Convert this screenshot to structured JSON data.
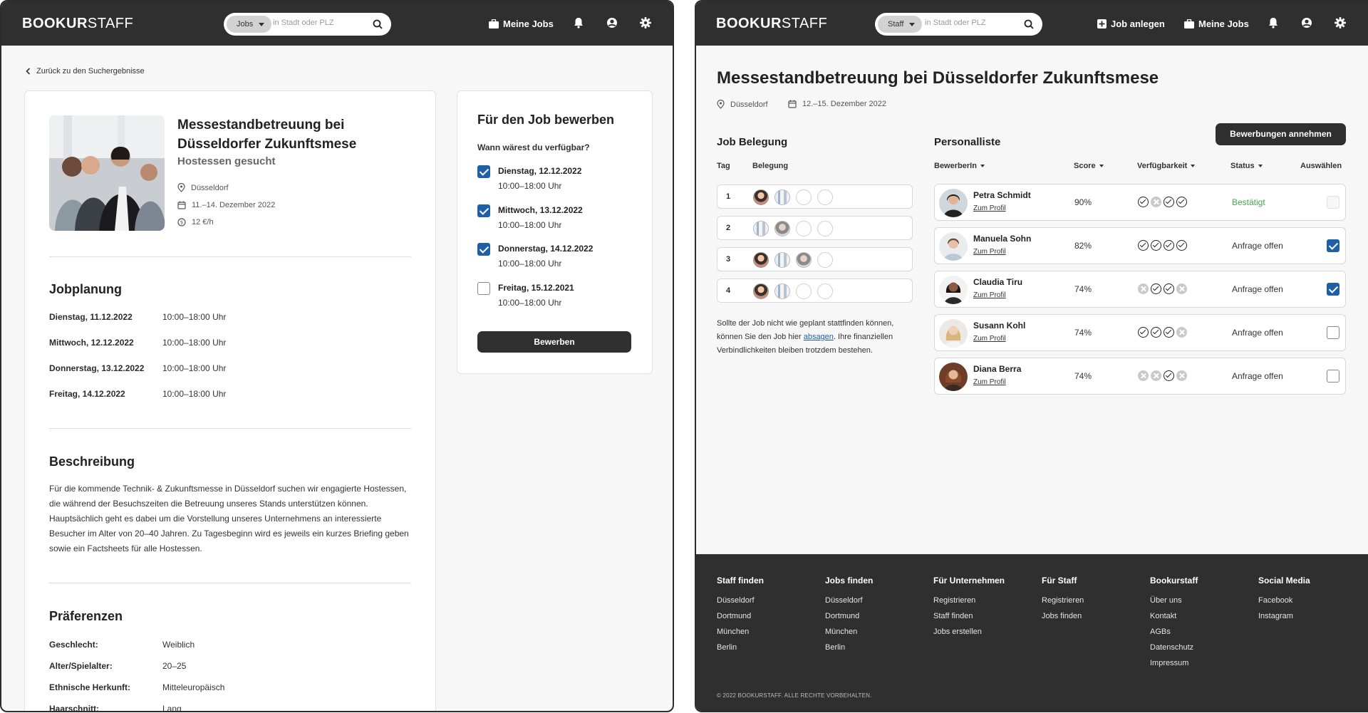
{
  "brand": {
    "name_bold": "BOOKUR",
    "name_thin": "STAFF"
  },
  "left": {
    "search": {
      "pill": "Jobs",
      "placeholder": "in Stadt oder PLZ"
    },
    "nav": {
      "my_jobs": "Meine Jobs"
    },
    "back": "Zurück zu den Suchergebnisse",
    "job": {
      "title": "Messestandbetreuung bei Düsseldorfer Zukunftsmese",
      "subtitle": "Hostessen gesucht",
      "location": "Düsseldorf",
      "date": "11.–14. Dezember 2022",
      "wage": "12 €/h"
    },
    "plan": {
      "heading": "Jobplanung",
      "rows": [
        {
          "day": "Dienstag, 11.12.2022",
          "time": "10:00–18:00 Uhr"
        },
        {
          "day": "Mittwoch, 12.12.2022",
          "time": "10:00–18:00 Uhr"
        },
        {
          "day": "Donnerstag, 13.12.2022",
          "time": "10:00–18:00 Uhr"
        },
        {
          "day": "Freitag, 14.12.2022",
          "time": "10:00–18:00 Uhr"
        }
      ]
    },
    "description": {
      "heading": "Beschreibung",
      "text": "Für die kommende Technik- & Zukunftsmesse in Düsseldorf suchen wir engagierte Hostessen, die während der Besuchszeiten die Betreuung unseres Stands unterstützen können. Hauptsächlich geht es dabei um die Vorstellung unseres Unternehmens an interessierte Besucher im Alter von 20–40 Jahren. Zu Tagesbeginn wird es jeweils ein kurzes Briefing geben sowie ein Factsheets für alle Hostessen."
    },
    "preferences": {
      "heading": "Präferenzen",
      "rows": [
        {
          "label": "Geschlecht:",
          "value": "Weiblich"
        },
        {
          "label": "Alter/Spielalter:",
          "value": "20–25"
        },
        {
          "label": "Ethnische Herkunft:",
          "value": "Mitteleuropäisch"
        },
        {
          "label": "Haarschnitt:",
          "value": "Lang"
        }
      ]
    },
    "apply": {
      "title": "Für den Job bewerben",
      "question": "Wann wärest du verfügbar?",
      "options": [
        {
          "day": "Dienstag, 12.12.2022",
          "time": "10:00–18:00 Uhr",
          "checked": true
        },
        {
          "day": "Mittwoch, 13.12.2022",
          "time": "10:00–18:00 Uhr",
          "checked": true
        },
        {
          "day": "Donnerstag, 14.12.2022",
          "time": "10:00–18:00 Uhr",
          "checked": true
        },
        {
          "day": "Freitag, 15.12.2021",
          "time": "10:00–18:00 Uhr",
          "checked": false
        }
      ],
      "button": "Bewerben"
    }
  },
  "right": {
    "search": {
      "pill": "Staff",
      "placeholder": "in Stadt oder PLZ"
    },
    "nav": {
      "create_job": "Job anlegen",
      "my_jobs": "Meine Jobs"
    },
    "title": "Messestandbetreuung bei Düsseldorfer Zukunftsmese",
    "location": "Düsseldorf",
    "date": "12.–15. Dezember 2022",
    "belegung": {
      "heading": "Job Belegung",
      "col_day": "Tag",
      "col_assign": "Belegung",
      "rows": [
        {
          "day": "1",
          "slots": [
            "f1",
            "f2",
            "",
            ""
          ]
        },
        {
          "day": "2",
          "slots": [
            "f2",
            "f3",
            "",
            ""
          ]
        },
        {
          "day": "3",
          "slots": [
            "f1",
            "f2",
            "f3",
            ""
          ]
        },
        {
          "day": "4",
          "slots": [
            "f1",
            "f2",
            "",
            ""
          ]
        }
      ],
      "note_before": "Sollte der Job nicht wie geplant stattfinden können, können Sie den Job hier ",
      "note_link": "absagen",
      "note_after": ". Ihre finanziellen Verbindlichkeiten bleiben trotzdem bestehen."
    },
    "staff": {
      "heading": "Personalliste",
      "accept_button": "Bewerbungen annehmen",
      "cols": {
        "applicant": "BewerberIn",
        "score": "Score",
        "availability": "Verfügbarkeit",
        "status": "Status",
        "select": "Auswählen"
      },
      "rows": [
        {
          "name": "Petra Schmidt",
          "profile": "Zum Profil",
          "score": "90%",
          "avail": [
            true,
            false,
            true,
            true
          ],
          "status": "Bestätigt",
          "confirmed": true,
          "selected": false
        },
        {
          "name": "Manuela Sohn",
          "profile": "Zum Profil",
          "score": "82%",
          "avail": [
            true,
            true,
            true,
            true
          ],
          "status": "Anfrage offen",
          "confirmed": false,
          "selected": true
        },
        {
          "name": "Claudia Tiru",
          "profile": "Zum Profil",
          "score": "74%",
          "avail": [
            false,
            true,
            true,
            false
          ],
          "status": "Anfrage offen",
          "confirmed": false,
          "selected": true
        },
        {
          "name": "Susann Kohl",
          "profile": "Zum Profil",
          "score": "74%",
          "avail": [
            true,
            true,
            true,
            false
          ],
          "status": "Anfrage offen",
          "confirmed": false,
          "selected": false
        },
        {
          "name": "Diana Berra",
          "profile": "Zum Profil",
          "score": "74%",
          "avail": [
            false,
            false,
            true,
            false
          ],
          "status": "Anfrage offen",
          "confirmed": false,
          "selected": false
        }
      ]
    },
    "footer": {
      "columns": [
        {
          "heading": "Staff finden",
          "links": [
            "Düsseldorf",
            "Dortmund",
            "München",
            "Berlin"
          ]
        },
        {
          "heading": "Jobs finden",
          "links": [
            "Düsseldorf",
            "Dortmund",
            "München",
            "Berlin"
          ]
        },
        {
          "heading": "Für Unternehmen",
          "links": [
            "Registrieren",
            "Staff finden",
            "Jobs erstellen"
          ]
        },
        {
          "heading": "Für Staff",
          "links": [
            "Registrieren",
            "Jobs finden"
          ]
        },
        {
          "heading": "Bookurstaff",
          "links": [
            "Über uns",
            "Kontakt",
            "AGBs",
            "Datenschutz",
            "Impressum"
          ]
        },
        {
          "heading": "Social Media",
          "links": [
            "Facebook",
            "Instagram"
          ]
        }
      ],
      "copyright": "© 2022 BOOKURSTAFF. ALLE RECHTE VORBEHALTEN."
    }
  },
  "colors": {
    "dark": "#2f2f2f",
    "accent_blue": "#1f5fa8",
    "confirmed_green": "#4aa34a",
    "page_bg": "#f7f7f7"
  },
  "icons": [
    "back-chevron-icon",
    "search-icon",
    "briefcase-icon",
    "bell-icon",
    "user-icon",
    "gear-icon",
    "pin-icon",
    "calendar-icon",
    "coin-icon",
    "plus-square-icon",
    "checkbox-icon",
    "check-circle-icon",
    "cross-circle-icon"
  ]
}
